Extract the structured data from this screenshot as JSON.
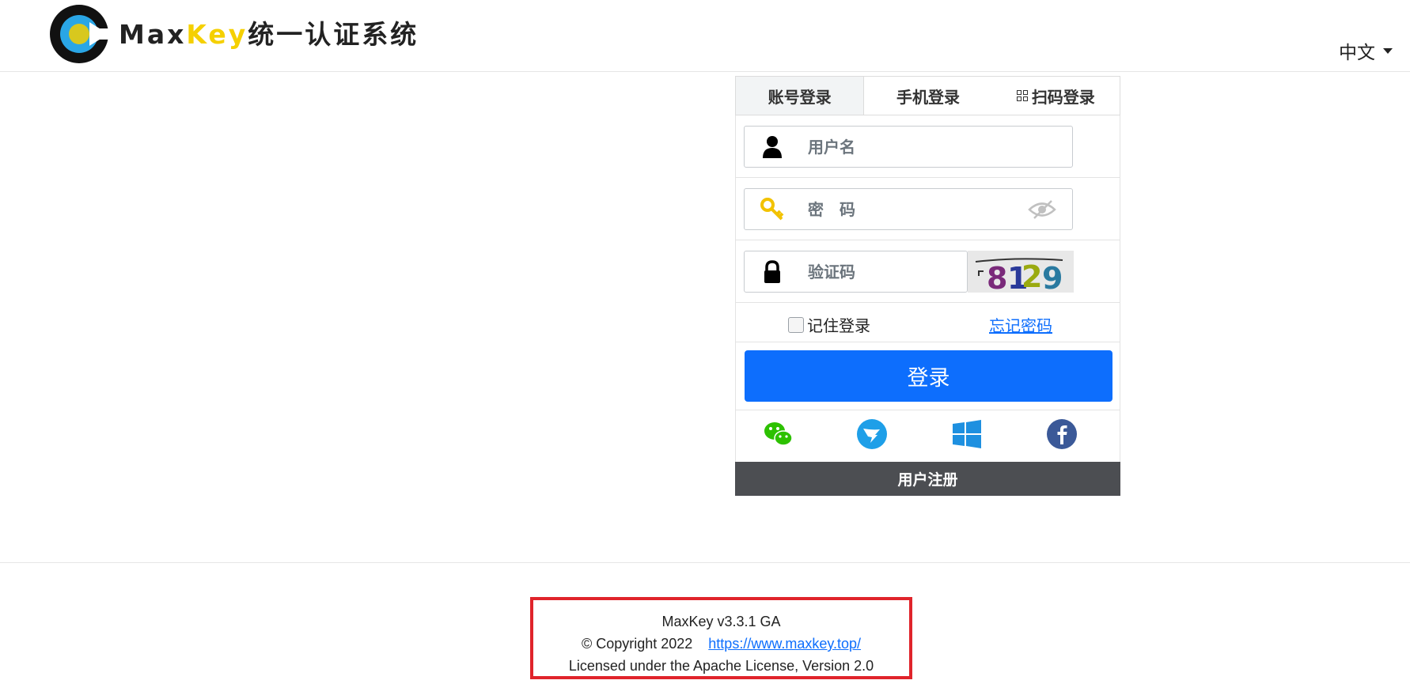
{
  "header": {
    "brand_prefix": "Max",
    "brand_key": "Key",
    "brand_suffix": "统一认证系统",
    "language": "中文"
  },
  "login": {
    "tabs": [
      {
        "label": "账号登录",
        "active": true
      },
      {
        "label": "手机登录",
        "active": false
      },
      {
        "label": "扫码登录",
        "active": false
      }
    ],
    "username_placeholder": "用户名",
    "password_placeholder": "密　码",
    "captcha_placeholder": "验证码",
    "captcha_text": "8129",
    "remember_label": "记住登录",
    "forgot_label": "忘记密码",
    "submit_label": "登录",
    "social": [
      "wechat-icon",
      "dingtalk-icon",
      "windows-icon",
      "facebook-icon"
    ],
    "register_label": "用户注册"
  },
  "footer": {
    "version": "MaxKey  v3.3.1 GA",
    "copyright": "© Copyright 2022",
    "link": "https://www.maxkey.top/",
    "license": "Licensed under the Apache License, Version 2.0"
  },
  "colors": {
    "primary": "#0d6efd",
    "brand_yellow": "#f5d000",
    "register_bg": "#4c4e52",
    "highlight_border": "#e0242b"
  }
}
